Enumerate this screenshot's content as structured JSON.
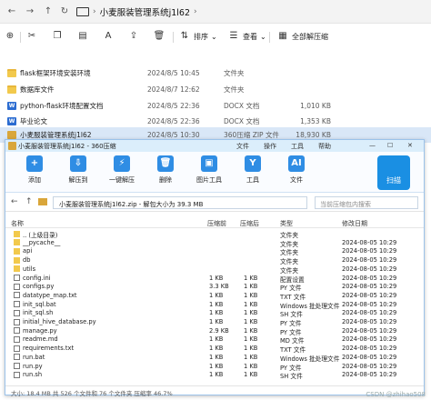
{
  "explorer": {
    "title_crumb": "小麦服装管理系统j1l62",
    "toolbar": {
      "sort": "排序",
      "view": "查看",
      "extract_all": "全部解压缩"
    },
    "files": [
      {
        "name": "flask框架环境安装环境",
        "date": "2024/8/5 10:45",
        "type": "文件夹",
        "size": "",
        "kind": "folder"
      },
      {
        "name": "数据库文件",
        "date": "2024/8/7 12:62",
        "type": "文件夹",
        "size": "",
        "kind": "folder"
      },
      {
        "name": "python-flask环境配置文档",
        "date": "2024/8/5 22:36",
        "type": "DOCX 文档",
        "size": "1,010 KB",
        "kind": "doc"
      },
      {
        "name": "毕业论文",
        "date": "2024/8/5 22:36",
        "type": "DOCX 文档",
        "size": "1,353 KB",
        "kind": "doc"
      },
      {
        "name": "小麦服装管理系统j1l62",
        "date": "2024/8/5 10:30",
        "type": "360压缩 ZIP 文件",
        "size": "18,930 KB",
        "kind": "zip"
      }
    ]
  },
  "zip": {
    "window_title": "小麦服装管理系统j1l62 - 360压缩",
    "menu": [
      "文件",
      "操作",
      "工具",
      "帮助"
    ],
    "tools": [
      {
        "label": "添加",
        "icon": "plus-icon",
        "color": "#2f8de4"
      },
      {
        "label": "解压到",
        "icon": "extract-icon",
        "color": "#2f8de4"
      },
      {
        "label": "一键解压",
        "icon": "one-click-extract-icon",
        "color": "#2f8de4"
      },
      {
        "label": "删除",
        "icon": "trash-icon",
        "color": "#2f8de4"
      },
      {
        "label": "图片工具",
        "icon": "image-tool-icon",
        "color": "#2f8de4"
      },
      {
        "label": "工具",
        "icon": "tools-icon",
        "color": "#2f8de4"
      },
      {
        "label": "文件",
        "icon": "ai-icon",
        "color": "#2f8de4"
      }
    ],
    "scan_label": "扫描",
    "address": "小麦服装管理系统j1l62.zip - 解包大小为 39.3 MB",
    "search_placeholder": "当前压缩包内搜索",
    "columns": [
      "名称",
      "压缩前",
      "压缩后",
      "类型",
      "修改日期"
    ],
    "rows": [
      {
        "name": ".. (上级目录)",
        "before": "",
        "after": "",
        "type": "文件夹",
        "date": "",
        "kind": "f"
      },
      {
        "name": "__pycache__",
        "before": "",
        "after": "",
        "type": "文件夹",
        "date": "2024-08-05 10:29",
        "kind": "f"
      },
      {
        "name": "api",
        "before": "",
        "after": "",
        "type": "文件夹",
        "date": "2024-08-05 10:29",
        "kind": "f"
      },
      {
        "name": "db",
        "before": "",
        "after": "",
        "type": "文件夹",
        "date": "2024-08-05 10:29",
        "kind": "f"
      },
      {
        "name": "utils",
        "before": "",
        "after": "",
        "type": "文件夹",
        "date": "2024-08-05 10:29",
        "kind": "f"
      },
      {
        "name": "config.ini",
        "before": "1 KB",
        "after": "1 KB",
        "type": "配置设置",
        "date": "2024-08-05 10:29",
        "kind": "p"
      },
      {
        "name": "configs.py",
        "before": "3.3 KB",
        "after": "1 KB",
        "type": "PY 文件",
        "date": "2024-08-05 10:29",
        "kind": "p"
      },
      {
        "name": "datatype_map.txt",
        "before": "1 KB",
        "after": "1 KB",
        "type": "TXT 文件",
        "date": "2024-08-05 10:29",
        "kind": "p"
      },
      {
        "name": "init_sql.bat",
        "before": "1 KB",
        "after": "1 KB",
        "type": "Windows 批处理文件",
        "date": "2024-08-05 10:29",
        "kind": "p"
      },
      {
        "name": "init_sql.sh",
        "before": "1 KB",
        "after": "1 KB",
        "type": "SH 文件",
        "date": "2024-08-05 10:29",
        "kind": "p"
      },
      {
        "name": "initial_hive_database.py",
        "before": "1 KB",
        "after": "1 KB",
        "type": "PY 文件",
        "date": "2024-08-05 10:29",
        "kind": "p"
      },
      {
        "name": "manage.py",
        "before": "2.9 KB",
        "after": "1 KB",
        "type": "PY 文件",
        "date": "2024-08-05 10:29",
        "kind": "p"
      },
      {
        "name": "readme.md",
        "before": "1 KB",
        "after": "1 KB",
        "type": "MD 文件",
        "date": "2024-08-05 10:29",
        "kind": "p"
      },
      {
        "name": "requirements.txt",
        "before": "1 KB",
        "after": "1 KB",
        "type": "TXT 文件",
        "date": "2024-08-05 10:29",
        "kind": "p"
      },
      {
        "name": "run.bat",
        "before": "1 KB",
        "after": "1 KB",
        "type": "Windows 批处理文件",
        "date": "2024-08-05 10:29",
        "kind": "p"
      },
      {
        "name": "run.py",
        "before": "1 KB",
        "after": "1 KB",
        "type": "PY 文件",
        "date": "2024-08-05 10:29",
        "kind": "p"
      },
      {
        "name": "run.sh",
        "before": "1 KB",
        "after": "1 KB",
        "type": "SH 文件",
        "date": "2024-08-05 10:29",
        "kind": "p"
      }
    ],
    "status_left": "大小: 18.4 MB 共 526 个文件和 76 个文件夹 压缩率 46.7%",
    "watermark": "CSDN @zhihao508"
  }
}
